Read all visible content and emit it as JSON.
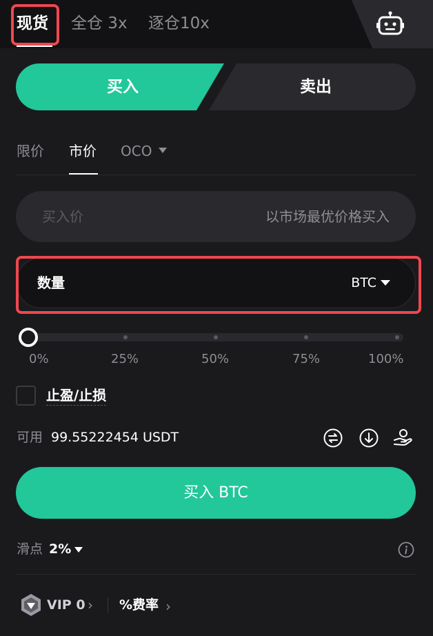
{
  "header": {
    "tabs": [
      {
        "label": "现货",
        "active": true
      },
      {
        "label": "全仓 3x",
        "active": false
      },
      {
        "label": "逐仓10x",
        "active": false
      }
    ],
    "robot_icon": "robot-icon"
  },
  "side_toggle": {
    "buy_label": "买入",
    "sell_label": "卖出",
    "selected": "买入"
  },
  "order_types": [
    {
      "label": "限价",
      "active": false
    },
    {
      "label": "市价",
      "active": true
    },
    {
      "label": "OCO",
      "active": false,
      "dropdown": true
    }
  ],
  "price_field": {
    "label": "买入价",
    "value": "以市场最优价格买入"
  },
  "quantity_field": {
    "label": "数量",
    "unit": "BTC"
  },
  "slider": {
    "value_percent": 0,
    "marks": [
      "0%",
      "25%",
      "50%",
      "75%",
      "100%"
    ]
  },
  "tpsl": {
    "label": "止盈/止损",
    "checked": false
  },
  "available": {
    "label": "可用",
    "value": "99.55222454 USDT",
    "icons": [
      "transfer-icon",
      "deposit-icon",
      "loan-icon"
    ]
  },
  "submit": {
    "label": "买入 BTC"
  },
  "slippage": {
    "label": "滑点",
    "value": "2%"
  },
  "vip": {
    "label": "VIP 0",
    "fee_label": "%费率"
  },
  "colors": {
    "accent": "#22c79a",
    "highlight": "#f0474f",
    "background": "#1a1a1d",
    "field": "#2a2a2e"
  }
}
